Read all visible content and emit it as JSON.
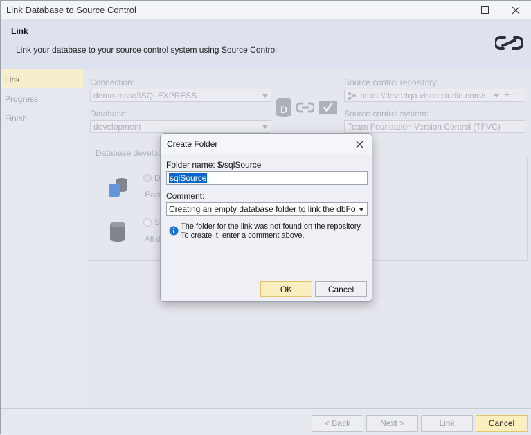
{
  "window": {
    "title": "Link Database to Source Control"
  },
  "header": {
    "title": "Link",
    "description": "Link your database to your source control system using Source Control"
  },
  "sidebar": {
    "items": [
      {
        "label": "Link",
        "active": true
      },
      {
        "label": "Progress",
        "active": false
      },
      {
        "label": "Finish",
        "active": false
      }
    ]
  },
  "main": {
    "connection_label": "Connection:",
    "connection_value": "demo-mssql\\SQLEXPRESS",
    "database_label": "Database:",
    "database_value": "development",
    "repo_label": "Source control repository:",
    "repo_value": "https://devartqa.visualstudio.com/s...",
    "system_label": "Source control system:",
    "system_value": "Team Foundation Version Control (TFVC)",
    "group_label": "Database developm",
    "option1_label": "D",
    "option1_desc": "Each",
    "option2_label": "S",
    "option2_desc": "All d"
  },
  "footer": {
    "back_label": "< Back",
    "next_label": "Next >",
    "link_label": "Link",
    "cancel_label": "Cancel"
  },
  "dialog": {
    "title": "Create Folder",
    "folder_name_label": "Folder name: $/sqlSource",
    "folder_name_value": "sqlSource",
    "comment_label": "Comment:",
    "comment_value": "Creating an empty database folder to link the dbForge S",
    "info_line1": "The folder for the link was not found on the repository.",
    "info_line2": "To create it, enter a comment above.",
    "ok_label": "OK",
    "cancel_label": "Cancel"
  },
  "colors": {
    "accent_button": "#fbefc0",
    "selection": "#0a64d0",
    "info_icon": "#1b73d8"
  }
}
